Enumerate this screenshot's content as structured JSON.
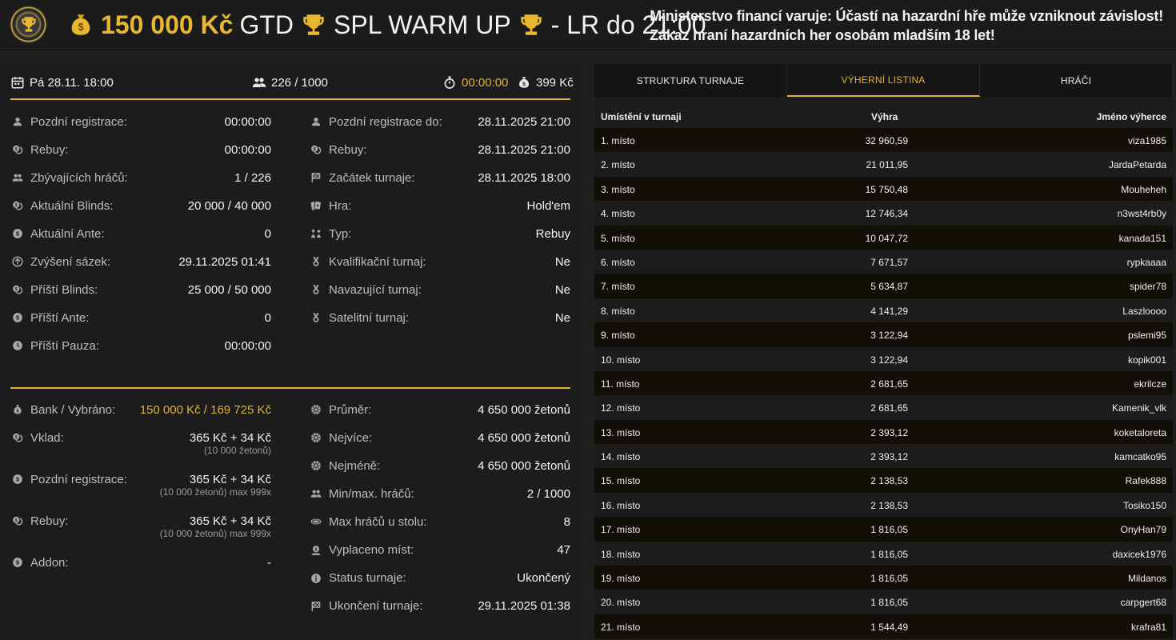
{
  "header": {
    "prize": "150 000 Kč",
    "title": "GTD",
    "event": "SPL WARM UP",
    "suffix": "- LR do 21:00",
    "warning_line1": "Ministerstvo financí varuje: Účastí na hazardní hře může vzniknout závislost!",
    "warning_line2": "Zákaz hraní hazardních her osobám mladším 18 let!"
  },
  "topbar": {
    "date": "Pá 28.11. 18:00",
    "players": "226 / 1000",
    "timer": "00:00:00",
    "buyin": "399 Kč"
  },
  "info_left": [
    {
      "icon": "user-icon",
      "label": "Pozdní registrace:",
      "value": "00:00:00"
    },
    {
      "icon": "coins-icon",
      "label": "Rebuy:",
      "value": "00:00:00"
    },
    {
      "icon": "users-icon",
      "label": "Zbývajících hráčů:",
      "value": "1 / 226"
    },
    {
      "icon": "coins-icon",
      "label": "Aktuální Blinds:",
      "value": "20 000 / 40 000"
    },
    {
      "icon": "dollar-icon",
      "label": "Aktuální Ante:",
      "value": "0"
    },
    {
      "icon": "arrow-up-icon",
      "label": "Zvýšení sázek:",
      "value": "29.11.2025 01:41"
    },
    {
      "icon": "coins-icon",
      "label": "Příští Blinds:",
      "value": "25 000 / 50 000"
    },
    {
      "icon": "dollar-icon",
      "label": "Příští Ante:",
      "value": "0"
    },
    {
      "icon": "clock-icon",
      "label": "Příští Pauza:",
      "value": "00:00:00"
    }
  ],
  "info_right": [
    {
      "icon": "user-icon",
      "label": "Pozdní registrace do:",
      "value": "28.11.2025 21:00"
    },
    {
      "icon": "coins-icon",
      "label": "Rebuy:",
      "value": "28.11.2025 21:00"
    },
    {
      "icon": "flag-icon",
      "label": "Začátek turnaje:",
      "value": "28.11.2025 18:00"
    },
    {
      "icon": "cards-icon",
      "label": "Hra:",
      "value": "Hold'em"
    },
    {
      "icon": "suits-icon",
      "label": "Typ:",
      "value": "Rebuy"
    },
    {
      "icon": "medal-icon",
      "label": "Kvalifikační turnaj:",
      "value": "Ne"
    },
    {
      "icon": "medal-icon",
      "label": "Navazující turnaj:",
      "value": "Ne"
    },
    {
      "icon": "medal-icon",
      "label": "Satelitní turnaj:",
      "value": "Ne"
    }
  ],
  "bank_left": [
    {
      "icon": "moneybag-icon",
      "label": "Bank / Vybráno:",
      "value": "150 000 Kč / 169 725 Kč",
      "sub": "",
      "gold": true
    },
    {
      "icon": "coins-icon",
      "label": "Vklad:",
      "value": "365 Kč + 34 Kč",
      "sub": "(10 000 žetonů)"
    },
    {
      "icon": "dollar-icon",
      "label": "Pozdní registrace:",
      "value": "365 Kč + 34 Kč",
      "sub": "(10 000 žetonů) max 999x"
    },
    {
      "icon": "coins-icon",
      "label": "Rebuy:",
      "value": "365 Kč + 34 Kč",
      "sub": "(10 000 žetonů) max 999x"
    },
    {
      "icon": "dollar-icon",
      "label": "Addon:",
      "value": "-",
      "sub": ""
    }
  ],
  "bank_right": [
    {
      "icon": "chip-icon",
      "label": "Průměr:",
      "value": "4 650 000 žetonů"
    },
    {
      "icon": "chip-icon",
      "label": "Nejvíce:",
      "value": "4 650 000 žetonů"
    },
    {
      "icon": "chip-icon",
      "label": "Nejméně:",
      "value": "4 650 000 žetonů"
    },
    {
      "icon": "users-icon",
      "label": "Min/max. hráčů:",
      "value": "2 / 1000"
    },
    {
      "icon": "table-icon",
      "label": "Max hráčů u stolu:",
      "value": "8"
    },
    {
      "icon": "payout-icon",
      "label": "Vyplaceno míst:",
      "value": "47"
    },
    {
      "icon": "info-icon",
      "label": "Status turnaje:",
      "value": "Ukončený"
    },
    {
      "icon": "flag-icon",
      "label": "Ukončení turnaje:",
      "value": "29.11.2025 01:38"
    }
  ],
  "tabs": [
    {
      "label": "STRUKTURA TURNAJE",
      "active": false
    },
    {
      "label": "VÝHERNÍ LISTINA",
      "active": true
    },
    {
      "label": "HRÁČI",
      "active": false
    }
  ],
  "table": {
    "headers": [
      "Umístění v turnaji",
      "Výhra",
      "Jméno výherce"
    ],
    "rows": [
      [
        "1. místo",
        "32 960,59",
        "viza1985"
      ],
      [
        "2. místo",
        "21 011,95",
        "JardaPetarda"
      ],
      [
        "3. místo",
        "15 750,48",
        "Mouheheh"
      ],
      [
        "4. místo",
        "12 746,34",
        "n3wst4rb0y"
      ],
      [
        "5. místo",
        "10 047,72",
        "kanada151"
      ],
      [
        "6. místo",
        "7 671,57",
        "rypkaaaa"
      ],
      [
        "7. místo",
        "5 634,87",
        "spider78"
      ],
      [
        "8. místo",
        "4 141,29",
        "Laszloooo"
      ],
      [
        "9. místo",
        "3 122,94",
        "pslemi95"
      ],
      [
        "10. místo",
        "3 122,94",
        "kopik001"
      ],
      [
        "11. místo",
        "2 681,65",
        "ekrilcze"
      ],
      [
        "12. místo",
        "2 681,65",
        "Kamenik_vlk"
      ],
      [
        "13. místo",
        "2 393,12",
        "koketaloreta"
      ],
      [
        "14. místo",
        "2 393,12",
        "kamcatko95"
      ],
      [
        "15. místo",
        "2 138,53",
        "Rafek888"
      ],
      [
        "16. místo",
        "2 138,53",
        "Tosiko150"
      ],
      [
        "17. místo",
        "1 816,05",
        "OnyHan79"
      ],
      [
        "18. místo",
        "1 816,05",
        "daxicek1976"
      ],
      [
        "19. místo",
        "1 816,05",
        "Mildanos"
      ],
      [
        "20. místo",
        "1 816,05",
        "carpgert68"
      ],
      [
        "21. místo",
        "1 544,49",
        "krafra81"
      ]
    ]
  }
}
